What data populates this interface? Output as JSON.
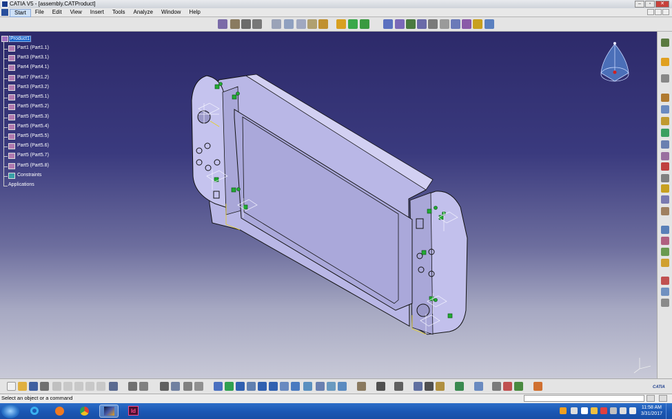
{
  "window": {
    "title": "CATIA V5 - [assembly.CATProduct]"
  },
  "menu": {
    "items": [
      "Start",
      "File",
      "Edit",
      "View",
      "Insert",
      "Tools",
      "Analyze",
      "Window",
      "Help"
    ]
  },
  "tree": {
    "root": "Product1",
    "parts": [
      "Part1 (Part1.1)",
      "Part3 (Part3.1)",
      "Part4 (Part4.1)",
      "Part7 (Part1.2)",
      "Part3 (Part3.2)",
      "Part5 (Part5.1)",
      "Part5 (Part5.2)",
      "Part5 (Part5.3)",
      "Part5 (Part5.4)",
      "Part5 (Part5.5)",
      "Part5 (Part5.6)",
      "Part5 (Part5.7)",
      "Part5 (Part5.8)"
    ],
    "constraints": "Constraints",
    "applications": "Applications"
  },
  "status": {
    "message": "Select an object or a command"
  },
  "clock": {
    "time": "11:58 AM",
    "date": "3/31/2017"
  },
  "taskbar": {
    "indesign_label": "Id"
  },
  "brand": {
    "logo": "CATIA"
  },
  "colors": {
    "viewport_top": "#2d2a6a",
    "viewport_bottom": "#c8c9d7",
    "model": "#b9b7e6",
    "constraint": "#22aa33"
  }
}
